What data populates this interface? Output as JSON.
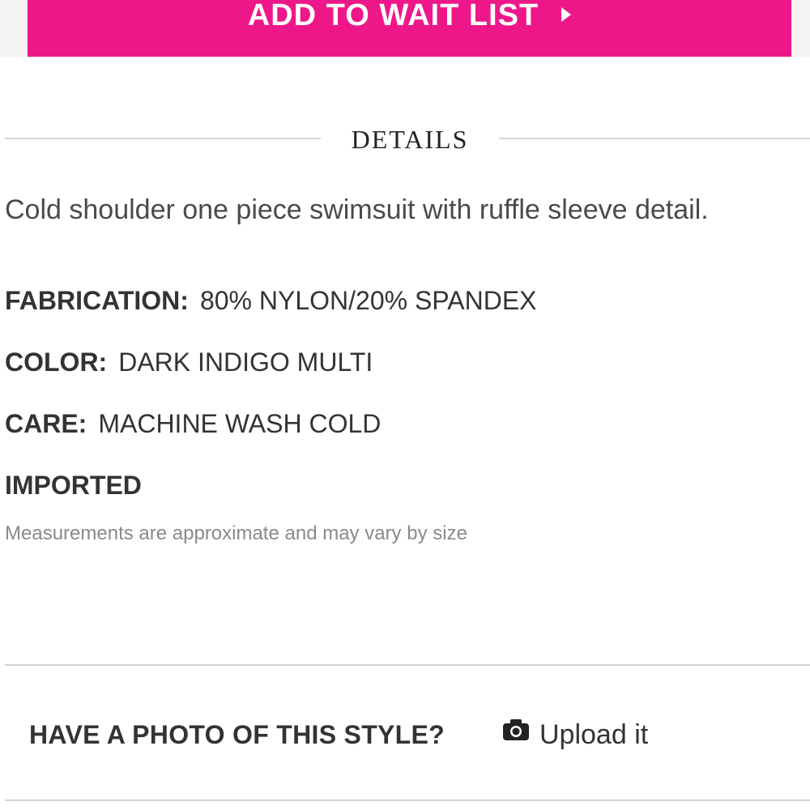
{
  "top": {
    "button_label": "ADD TO WAIT LIST",
    "button_color": "#ee1789"
  },
  "details": {
    "heading": "DETAILS",
    "description": "Cold shoulder one piece swimsuit with ruffle sleeve detail.",
    "specs": [
      {
        "key": "FABRICATION:",
        "value": "80% NYLON/20% SPANDEX"
      },
      {
        "key": "COLOR:",
        "value": "DARK INDIGO MULTI"
      },
      {
        "key": "CARE:",
        "value": "MACHINE WASH COLD"
      }
    ],
    "imported": "IMPORTED",
    "note": "Measurements are approximate and may vary by size"
  },
  "photo": {
    "prompt": "HAVE A PHOTO OF THIS STYLE?",
    "icon": "camera-icon",
    "upload_label": "Upload it"
  }
}
